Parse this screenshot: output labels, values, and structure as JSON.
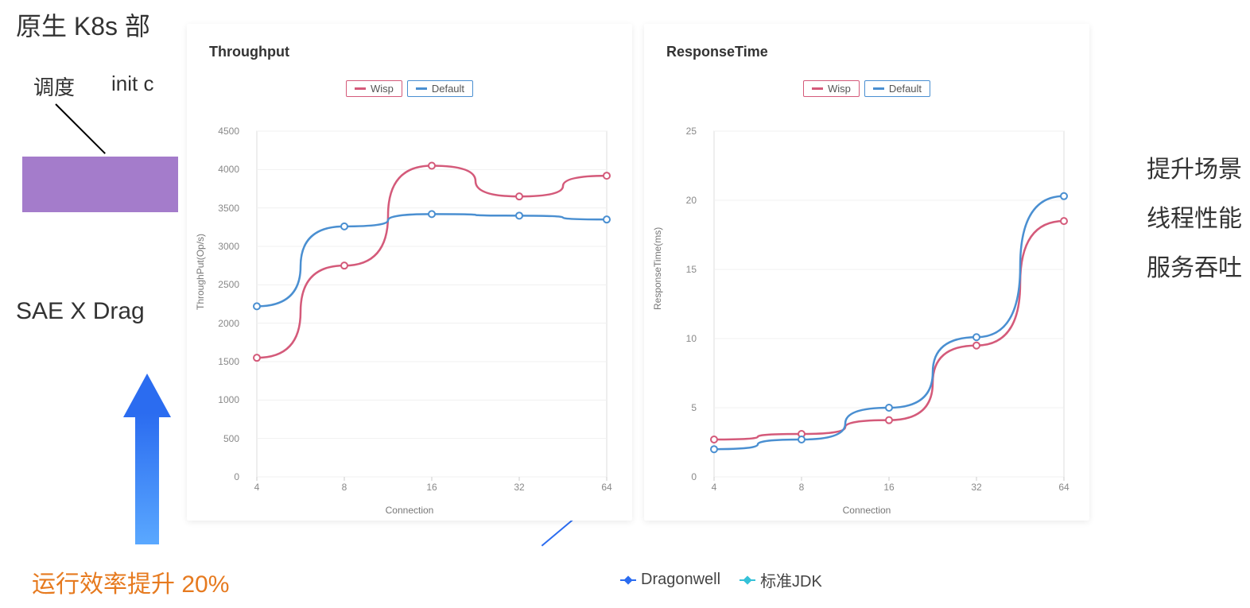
{
  "background": {
    "title_fragment": "原生 K8s 部",
    "label_schedule": "调度",
    "label_init": "init c",
    "sae_text": "SAE X Drag",
    "efficiency_text": "运行效率提升 20%",
    "right_lines": [
      "提升场景",
      "线程性能",
      "服务吞吐"
    ]
  },
  "bottom_legend": {
    "item1": "Dragonwell",
    "item2": "标准JDK"
  },
  "charts": {
    "throughput": {
      "title": "Throughput",
      "legend": {
        "wisp": "Wisp",
        "default": "Default"
      },
      "ylabel": "ThroughPut(Op/s)",
      "xlabel": "Connection"
    },
    "response": {
      "title": "ResponseTime",
      "legend": {
        "wisp": "Wisp",
        "default": "Default"
      },
      "ylabel": "ResponseTime(ms)",
      "xlabel": "Connection"
    }
  },
  "chart_data": [
    {
      "id": "throughput",
      "type": "line",
      "title": "Throughput",
      "xlabel": "Connection",
      "ylabel": "ThroughPut(Op/s)",
      "categories": [
        "4",
        "8",
        "16",
        "32",
        "64"
      ],
      "ylim": [
        0,
        4500
      ],
      "yticks": [
        0,
        500,
        1000,
        1500,
        2000,
        2500,
        3000,
        3500,
        4000,
        4500
      ],
      "series": [
        {
          "name": "Wisp",
          "color": "#d45a7a",
          "values": [
            1550,
            2750,
            4050,
            3650,
            3920
          ]
        },
        {
          "name": "Default",
          "color": "#4a8fd1",
          "values": [
            2220,
            3260,
            3420,
            3400,
            3350
          ]
        }
      ]
    },
    {
      "id": "response",
      "type": "line",
      "title": "ResponseTime",
      "xlabel": "Connection",
      "ylabel": "ResponseTime(ms)",
      "categories": [
        "4",
        "8",
        "16",
        "32",
        "64"
      ],
      "ylim": [
        0,
        25
      ],
      "yticks": [
        0,
        5,
        10,
        15,
        20,
        25
      ],
      "series": [
        {
          "name": "Wisp",
          "color": "#d45a7a",
          "values": [
            2.7,
            3.1,
            4.1,
            9.5,
            18.5
          ]
        },
        {
          "name": "Default",
          "color": "#4a8fd1",
          "values": [
            2.0,
            2.7,
            5.0,
            10.1,
            20.3
          ]
        }
      ]
    }
  ]
}
